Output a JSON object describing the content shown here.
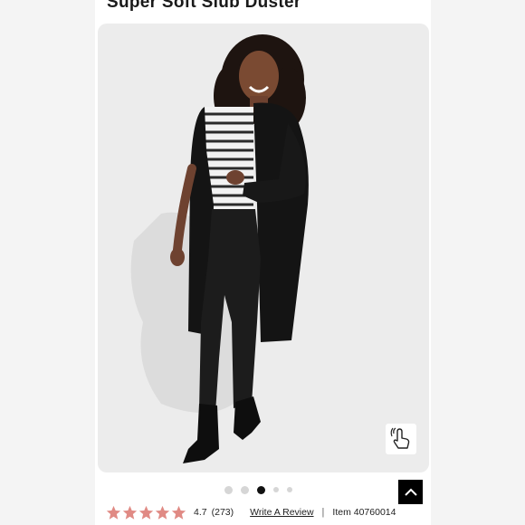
{
  "product": {
    "title": "Super Soft Slub Duster",
    "image_alt": "Model wearing black long duster cardigan",
    "zoom_icon": "hand-pointer-icon"
  },
  "carousel": {
    "dot_count": 5,
    "active_index": 2
  },
  "rating": {
    "stars": 5,
    "star_color": "#e08a84",
    "value": "4.7",
    "count": "(273)",
    "write_review_label": "Write A Review",
    "separator": "|",
    "item_label": "Item 40760014"
  },
  "scroll_top": {
    "icon": "chevron-up-icon"
  }
}
